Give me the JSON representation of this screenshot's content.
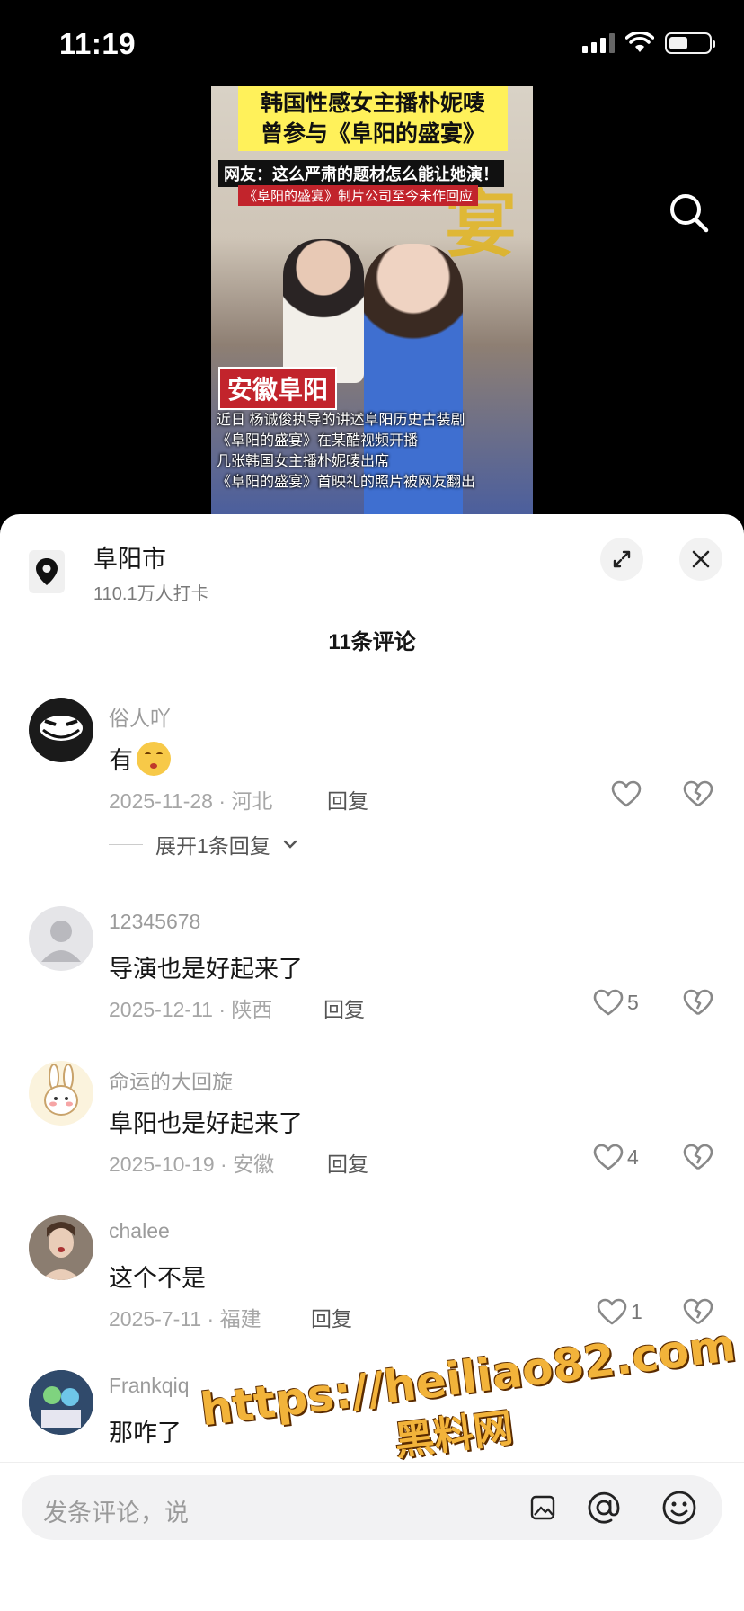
{
  "status_bar": {
    "time": "11:19"
  },
  "video": {
    "title_line1": "韩国性感女主播朴妮唛",
    "title_line2": "曾参与《阜阳的盛宴》",
    "sub_black": "网友：这么严肃的题材怎么能让她演！",
    "sub_red": "《阜阳的盛宴》制片公司至今未作回应",
    "tag": "安徽阜阳",
    "caption": [
      "近日 杨诚俊执导的讲述阜阳历史古装剧",
      "《阜阳的盛宴》在某酷视频开播",
      "几张韩国女主播朴妮唛出席",
      "《阜阳的盛宴》首映礼的照片被网友翻出"
    ],
    "bg_glyph": "宴"
  },
  "location": {
    "name": "阜阳市",
    "count": "110.1万人打卡"
  },
  "comments_header": "11条评论",
  "comments": [
    {
      "user": "俗人吖",
      "text": "有",
      "date": "2025-11-28 · 河北",
      "reply": "回复",
      "likes": "",
      "expand": "展开1条回复"
    },
    {
      "user": "12345678",
      "text": "导演也是好起来了",
      "date": "2025-12-11 · 陕西",
      "reply": "回复",
      "likes": "5"
    },
    {
      "user": "命运的大回旋",
      "text": "阜阳也是好起来了",
      "date": "2025-10-19 · 安徽",
      "reply": "回复",
      "likes": "4"
    },
    {
      "user": "chalee",
      "text": "这个不是",
      "date": "2025-7-11 · 福建",
      "reply": "回复",
      "likes": "1"
    },
    {
      "user": "Frankqiq",
      "text": "那咋了",
      "date": "",
      "reply": "",
      "likes": ""
    }
  ],
  "input": {
    "placeholder": "发条评论，说"
  },
  "watermark": {
    "url": "https://heiliao82.com",
    "name": "黑料网"
  },
  "colors": {
    "watermark": "#f2b33a",
    "sheet_bg": "#ffffff",
    "video_bg": "#000000"
  }
}
